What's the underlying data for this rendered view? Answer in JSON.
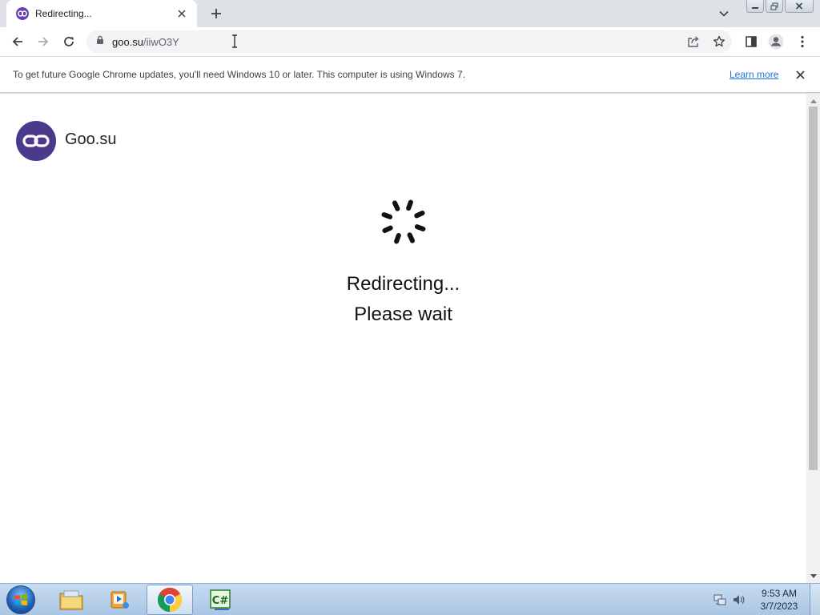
{
  "browser": {
    "tab": {
      "title": "Redirecting..."
    },
    "address": {
      "host": "goo.su",
      "path": "/iiwO3Y"
    }
  },
  "infobar": {
    "message": "To get future Google Chrome updates, you'll need Windows 10 or later. This computer is using Windows 7.",
    "link_label": "Learn more"
  },
  "page": {
    "site_name": "Goo.su",
    "line1": "Redirecting...",
    "line2": "Please wait"
  },
  "taskbar": {
    "pinned": [
      "windows-explorer",
      "media-player",
      "google-chrome",
      "csharp-editor"
    ],
    "active": "google-chrome",
    "clock_time": "9:53 AM",
    "clock_date": "3/7/2023"
  },
  "colors": {
    "tabstrip": "#dee1e6",
    "omnibox": "#f1f3f4",
    "link": "#1a73e8",
    "logo": "#4b3a8c",
    "favicon": "#6a3fb5"
  }
}
